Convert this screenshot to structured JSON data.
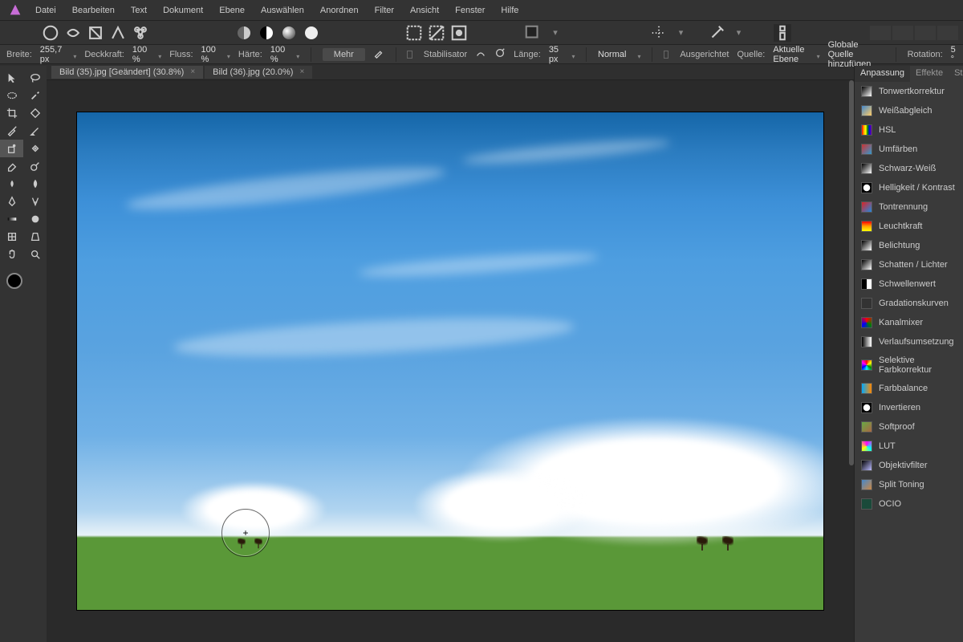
{
  "menu": [
    "Datei",
    "Bearbeiten",
    "Text",
    "Dokument",
    "Ebene",
    "Auswählen",
    "Anordnen",
    "Filter",
    "Ansicht",
    "Fenster",
    "Hilfe"
  ],
  "context": {
    "breite_lbl": "Breite:",
    "breite_val": "255,7 px",
    "deck_lbl": "Deckkraft:",
    "deck_val": "100 %",
    "fluss_lbl": "Fluss:",
    "fluss_val": "100 %",
    "haerte_lbl": "Härte:",
    "haerte_val": "100 %",
    "mehr": "Mehr",
    "stab_lbl": "Stabilisator",
    "len_lbl": "Länge:",
    "len_val": "35 px",
    "blend": "Normal",
    "aus_lbl": "Ausgerichtet",
    "quelle_lbl": "Quelle:",
    "quelle_val": "Aktuelle Ebene",
    "global": "Globale Quelle hinzufügen",
    "rot_lbl": "Rotation:",
    "rot_val": "5 °"
  },
  "tabs": [
    {
      "label": "Bild (35).jpg [Geändert] (30.8%)",
      "active": true
    },
    {
      "label": "Bild (36).jpg (20.0%)",
      "active": false
    }
  ],
  "rp_tabs": [
    "Anpassung",
    "Effekte",
    "Stile"
  ],
  "adjustments": [
    {
      "label": "Tonwertkorrektur",
      "color": "linear-gradient(135deg,#000,#fff)"
    },
    {
      "label": "Weißabgleich",
      "color": "linear-gradient(135deg,#48c,#fc6)"
    },
    {
      "label": "HSL",
      "color": "linear-gradient(90deg,red,orange,yellow,green,blue,purple)"
    },
    {
      "label": "Umfärben",
      "color": "linear-gradient(135deg,#c33,#39c)"
    },
    {
      "label": "Schwarz-Weiß",
      "color": "linear-gradient(135deg,#000,#fff)"
    },
    {
      "label": "Helligkeit / Kontrast",
      "color": "radial-gradient(circle,#fff 48%,#000 52%)"
    },
    {
      "label": "Tontrennung",
      "color": "linear-gradient(135deg,#d22,#28d)"
    },
    {
      "label": "Leuchtkraft",
      "color": "linear-gradient(180deg,red,orange,yellow)"
    },
    {
      "label": "Belichtung",
      "color": "linear-gradient(135deg,#000,#fff)"
    },
    {
      "label": "Schatten / Lichter",
      "color": "linear-gradient(135deg,#000,#fff)"
    },
    {
      "label": "Schwellenwert",
      "color": "linear-gradient(90deg,#000 50%,#fff 50%)"
    },
    {
      "label": "Gradationskurven",
      "color": "#333"
    },
    {
      "label": "Kanalmixer",
      "color": "conic-gradient(red,green,blue,red)"
    },
    {
      "label": "Verlaufsumsetzung",
      "color": "linear-gradient(90deg,#000,#888,#fff)"
    },
    {
      "label": "Selektive Farbkorrektur",
      "color": "conic-gradient(red,yellow,green,cyan,blue,magenta,red)"
    },
    {
      "label": "Farbbalance",
      "color": "linear-gradient(90deg,#0af,#f80)"
    },
    {
      "label": "Invertieren",
      "color": "radial-gradient(circle,#fff 48%,#000 52%)"
    },
    {
      "label": "Softproof",
      "color": "linear-gradient(135deg,#6a4,#a64)"
    },
    {
      "label": "LUT",
      "color": "conic-gradient(#f0f,#0ff,#ff0,#f0f)"
    },
    {
      "label": "Objektivfilter",
      "color": "linear-gradient(135deg,#000,#bbf)"
    },
    {
      "label": "Split Toning",
      "color": "linear-gradient(135deg,#48c,#c84)"
    },
    {
      "label": "OCIO",
      "color": "#1a4a3a"
    }
  ]
}
